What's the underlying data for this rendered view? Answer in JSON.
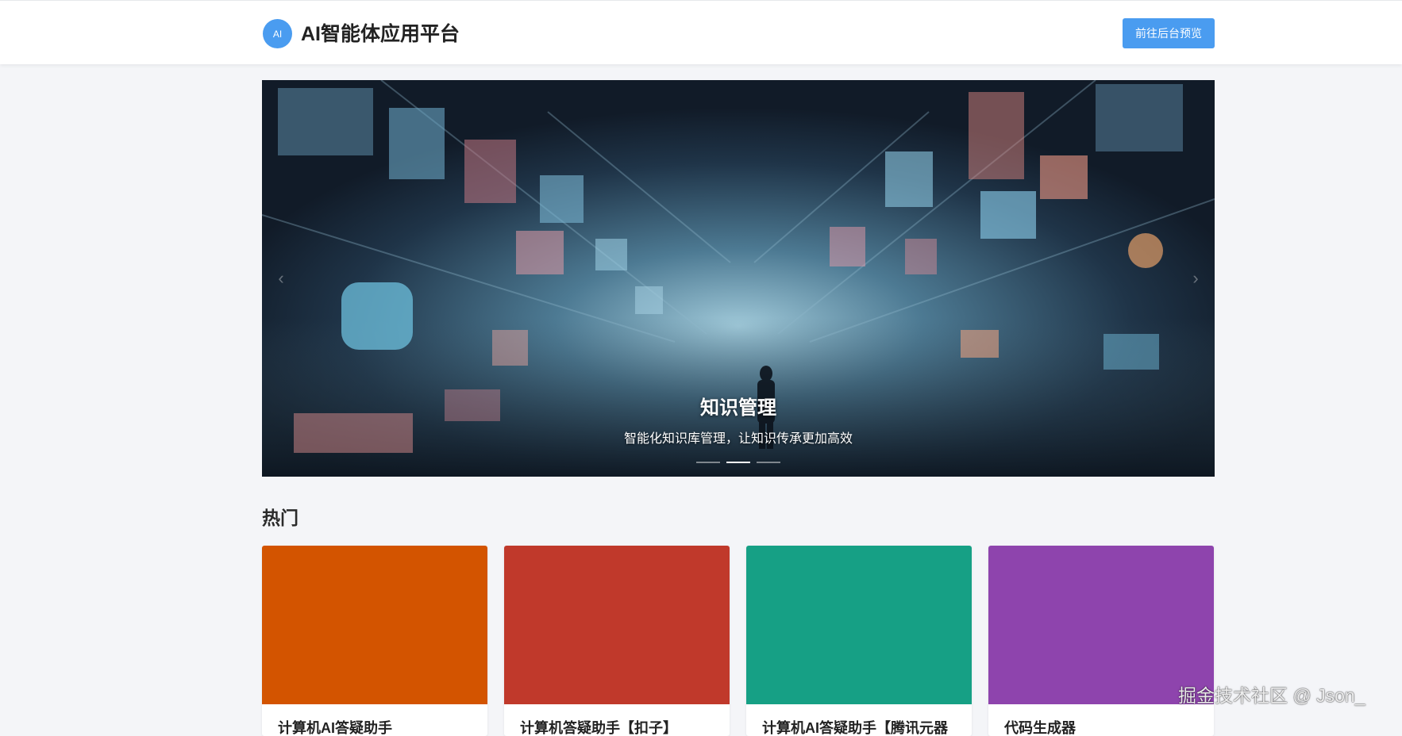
{
  "header": {
    "logo_text": "AI",
    "app_title": "AI智能体应用平台",
    "admin_button_label": "前往后台预览"
  },
  "carousel": {
    "current_slide": {
      "title": "知识管理",
      "description": "智能化知识库管理，让知识传承更加高效"
    },
    "indicator_count": 3,
    "active_index": 1,
    "prev_arrow": "‹",
    "next_arrow": "›"
  },
  "hot_section": {
    "title": "热门",
    "cards": [
      {
        "title": "计算机AI答疑助手",
        "cover_color": "#d35400"
      },
      {
        "title": "计算机答疑助手【扣子】",
        "cover_color": "#c0392b"
      },
      {
        "title": "计算机AI答疑助手【腾讯元器",
        "cover_color": "#16a085"
      },
      {
        "title": "代码生成器",
        "cover_color": "#8e44ad"
      }
    ]
  },
  "watermark": "掘金技术社区 @ Json_"
}
